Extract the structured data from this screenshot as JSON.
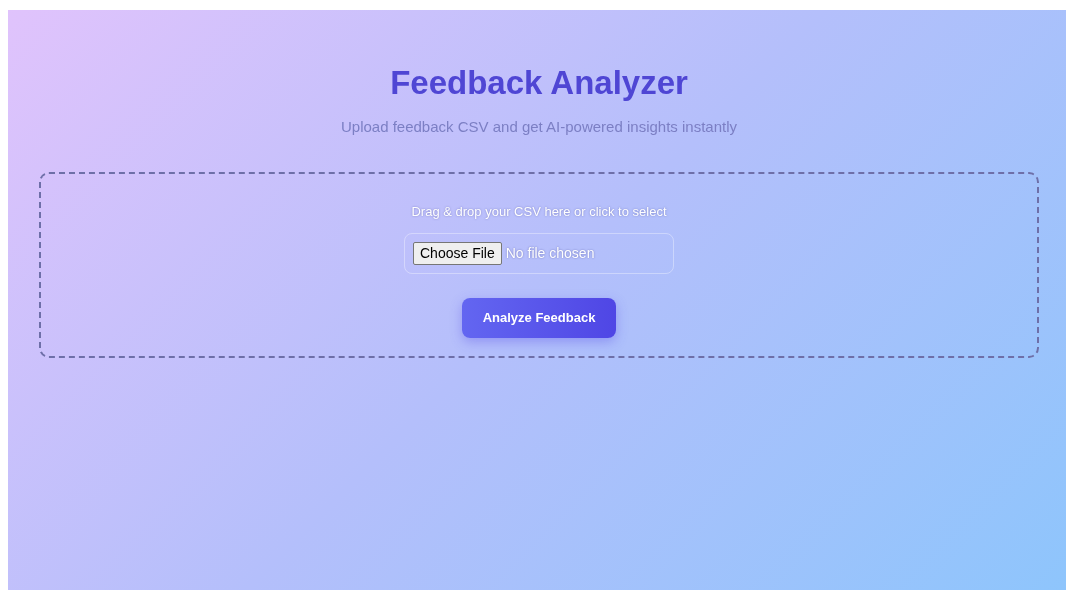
{
  "header": {
    "title": "Feedback Analyzer",
    "subtitle": "Upload feedback CSV and get AI-powered insights instantly"
  },
  "upload": {
    "hint": "Drag & drop your CSV here or click to select",
    "file_button": "Choose File",
    "file_status": "No file chosen"
  },
  "submit_button": "Analyze Feedback"
}
